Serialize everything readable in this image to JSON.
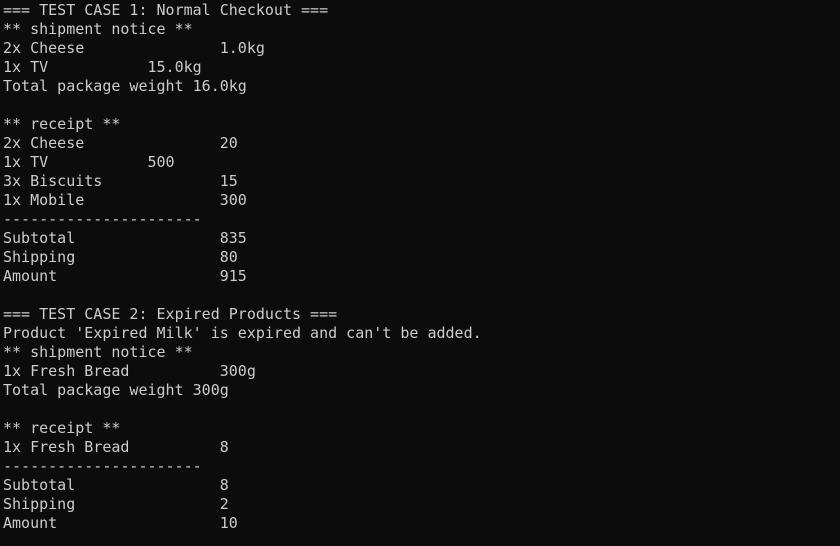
{
  "theme": {
    "background": "#0c0c0c",
    "foreground": "#cccccc"
  },
  "terminal": {
    "lines": [
      "=== TEST CASE 1: Normal Checkout ===",
      "** shipment notice **",
      "2x Cheese               1.0kg",
      "1x TV           15.0kg",
      "Total package weight 16.0kg",
      "",
      "** receipt **",
      "2x Cheese               20",
      "1x TV           500",
      "3x Biscuits             15",
      "1x Mobile               300",
      "----------------------",
      "Subtotal                835",
      "Shipping                80",
      "Amount                  915",
      "",
      "=== TEST CASE 2: Expired Products ===",
      "Product 'Expired Milk' is expired and can't be added.",
      "** shipment notice **",
      "1x Fresh Bread          300g",
      "Total package weight 300g",
      "",
      "** receipt **",
      "1x Fresh Bread          8",
      "----------------------",
      "Subtotal                8",
      "Shipping                2",
      "Amount                  10"
    ]
  }
}
